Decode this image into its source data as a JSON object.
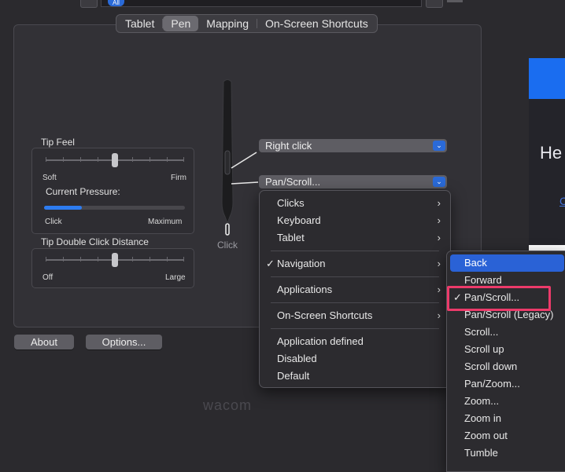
{
  "header": {
    "filter_chip": "All"
  },
  "tabs": [
    "Tablet",
    "Pen",
    "Mapping",
    "On-Screen Shortcuts"
  ],
  "tip_feel": {
    "title": "Tip Feel",
    "min_label": "Soft",
    "max_label": "Firm",
    "level": 0.5,
    "current_pressure_label": "Current Pressure:",
    "pressure_min_label": "Click",
    "pressure_max_label": "Maximum",
    "pressure_level": 0.27
  },
  "double_click": {
    "title": "Tip Double Click Distance",
    "min_label": "Off",
    "max_label": "Large",
    "level": 0.5
  },
  "pen": {
    "tip_label": "Click",
    "upper_button": "Right click",
    "lower_button": "Pan/Scroll..."
  },
  "menu": {
    "groups": [
      [
        "Clicks",
        "Keyboard",
        "Tablet"
      ],
      [
        "Navigation"
      ],
      [
        "Applications"
      ],
      [
        "On-Screen Shortcuts"
      ],
      [
        "Application defined",
        "Disabled",
        "Default"
      ]
    ],
    "checked": "Navigation"
  },
  "submenu": {
    "items": [
      "Back",
      "Forward",
      "Pan/Scroll...",
      "Pan/Scroll (Legacy)",
      "Scroll...",
      "Scroll up",
      "Scroll down",
      "Pan/Zoom...",
      "Zoom...",
      "Zoom in",
      "Zoom out",
      "Tumble"
    ],
    "highlighted": "Back",
    "checked": "Pan/Scroll..."
  },
  "buttons": {
    "about": "About",
    "options": "Options..."
  },
  "brand": "wacom",
  "background_window": {
    "heading": "He",
    "link": "C"
  },
  "colors": {
    "accent": "#2a62d6",
    "annotation": "#ec3a6a"
  }
}
